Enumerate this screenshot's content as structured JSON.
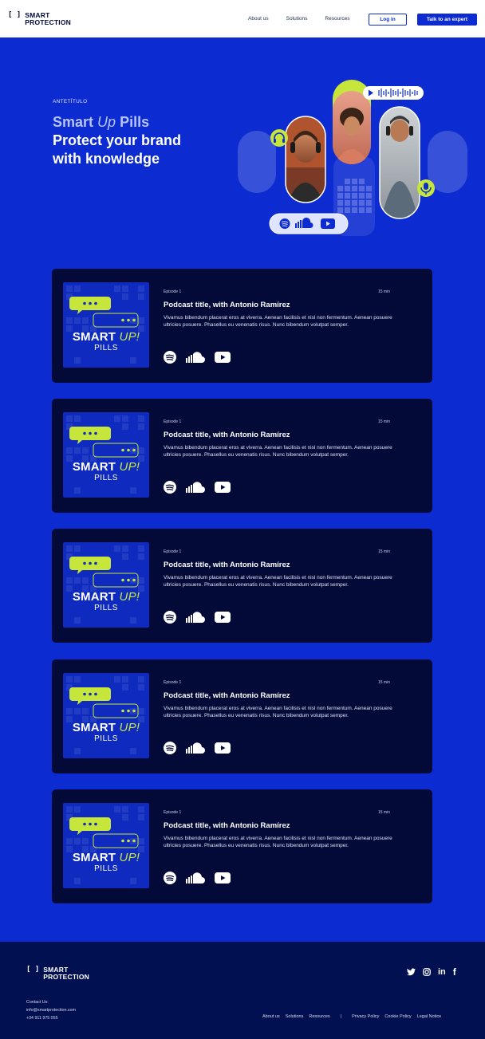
{
  "header": {
    "logo_mark": "[ ]",
    "logo_line1": "SMART",
    "logo_line2": "PROTECTION",
    "nav": [
      "About us",
      "Solutions",
      "Resources"
    ],
    "login_label": "Log in",
    "expert_label": "Talk to an expert"
  },
  "hero": {
    "eyebrow": "ANTETÍTULO",
    "title_smart": "Smart",
    "title_up": "Up",
    "title_pills": "Pills",
    "title_line2": "Protect your brand",
    "title_line3": "with knowledge"
  },
  "cover": {
    "smart": "SMART",
    "up": "UP!",
    "pills": "PILLS"
  },
  "episodes": [
    {
      "episode": "Episode 1",
      "duration": "15 min",
      "title": "Podcast title, with Antonio Ramírez",
      "description": "Vivamus bibendum placerat eros at viverra. Aenean facilisis et nisl non fermentum. Aenean posuere ultricies posuere. Phasellus eu venenatis risus. Nunc bibendum volutpat semper."
    },
    {
      "episode": "Episode 1",
      "duration": "15 min",
      "title": "Podcast title, with Antonio Ramírez",
      "description": "Vivamus bibendum placerat eros at viverra. Aenean facilisis et nisl non fermentum. Aenean posuere ultricies posuere. Phasellus eu venenatis risus. Nunc bibendum volutpat semper."
    },
    {
      "episode": "Episode 1",
      "duration": "15 min",
      "title": "Podcast title, with Antonio Ramírez",
      "description": "Vivamus bibendum placerat eros at viverra. Aenean facilisis et nisl non fermentum. Aenean posuere ultricies posuere. Phasellus eu venenatis risus. Nunc bibendum volutpat semper."
    },
    {
      "episode": "Episode 1",
      "duration": "15 min",
      "title": "Podcast title, with Antonio Ramírez",
      "description": "Vivamus bibendum placerat eros at viverra. Aenean facilisis et nisl non fermentum. Aenean posuere ultricies posuere. Phasellus eu venenatis risus. Nunc bibendum volutpat semper."
    },
    {
      "episode": "Episode 1",
      "duration": "15 min",
      "title": "Podcast title, with Antonio Ramírez",
      "description": "Vivamus bibendum placerat eros at viverra. Aenean facilisis et nisl non fermentum. Aenean posuere ultricies posuere. Phasellus eu venenatis risus. Nunc bibendum volutpat semper."
    }
  ],
  "platform_icons": [
    "spotify-icon",
    "soundcloud-icon",
    "youtube-icon"
  ],
  "footer": {
    "logo_mark": "[ ]",
    "logo_line1": "SMART",
    "logo_line2": "PROTECTION",
    "social": [
      "twitter-icon",
      "instagram-icon",
      "linkedin-icon",
      "facebook-icon"
    ],
    "contact_label": "Contact Us:",
    "email": "info@smartprotection.com",
    "phone": "+34 911 975 055",
    "links": [
      "About us",
      "Solutions",
      "Resources"
    ],
    "separator": "|",
    "legal_links": [
      "Privacy Policy",
      "Cookie Policy",
      "Legal Notice"
    ]
  },
  "colors": {
    "brand_blue": "#0c2bd1",
    "card_bg": "#030a38",
    "lime": "#c7e63b",
    "footer_bg": "#011051"
  }
}
